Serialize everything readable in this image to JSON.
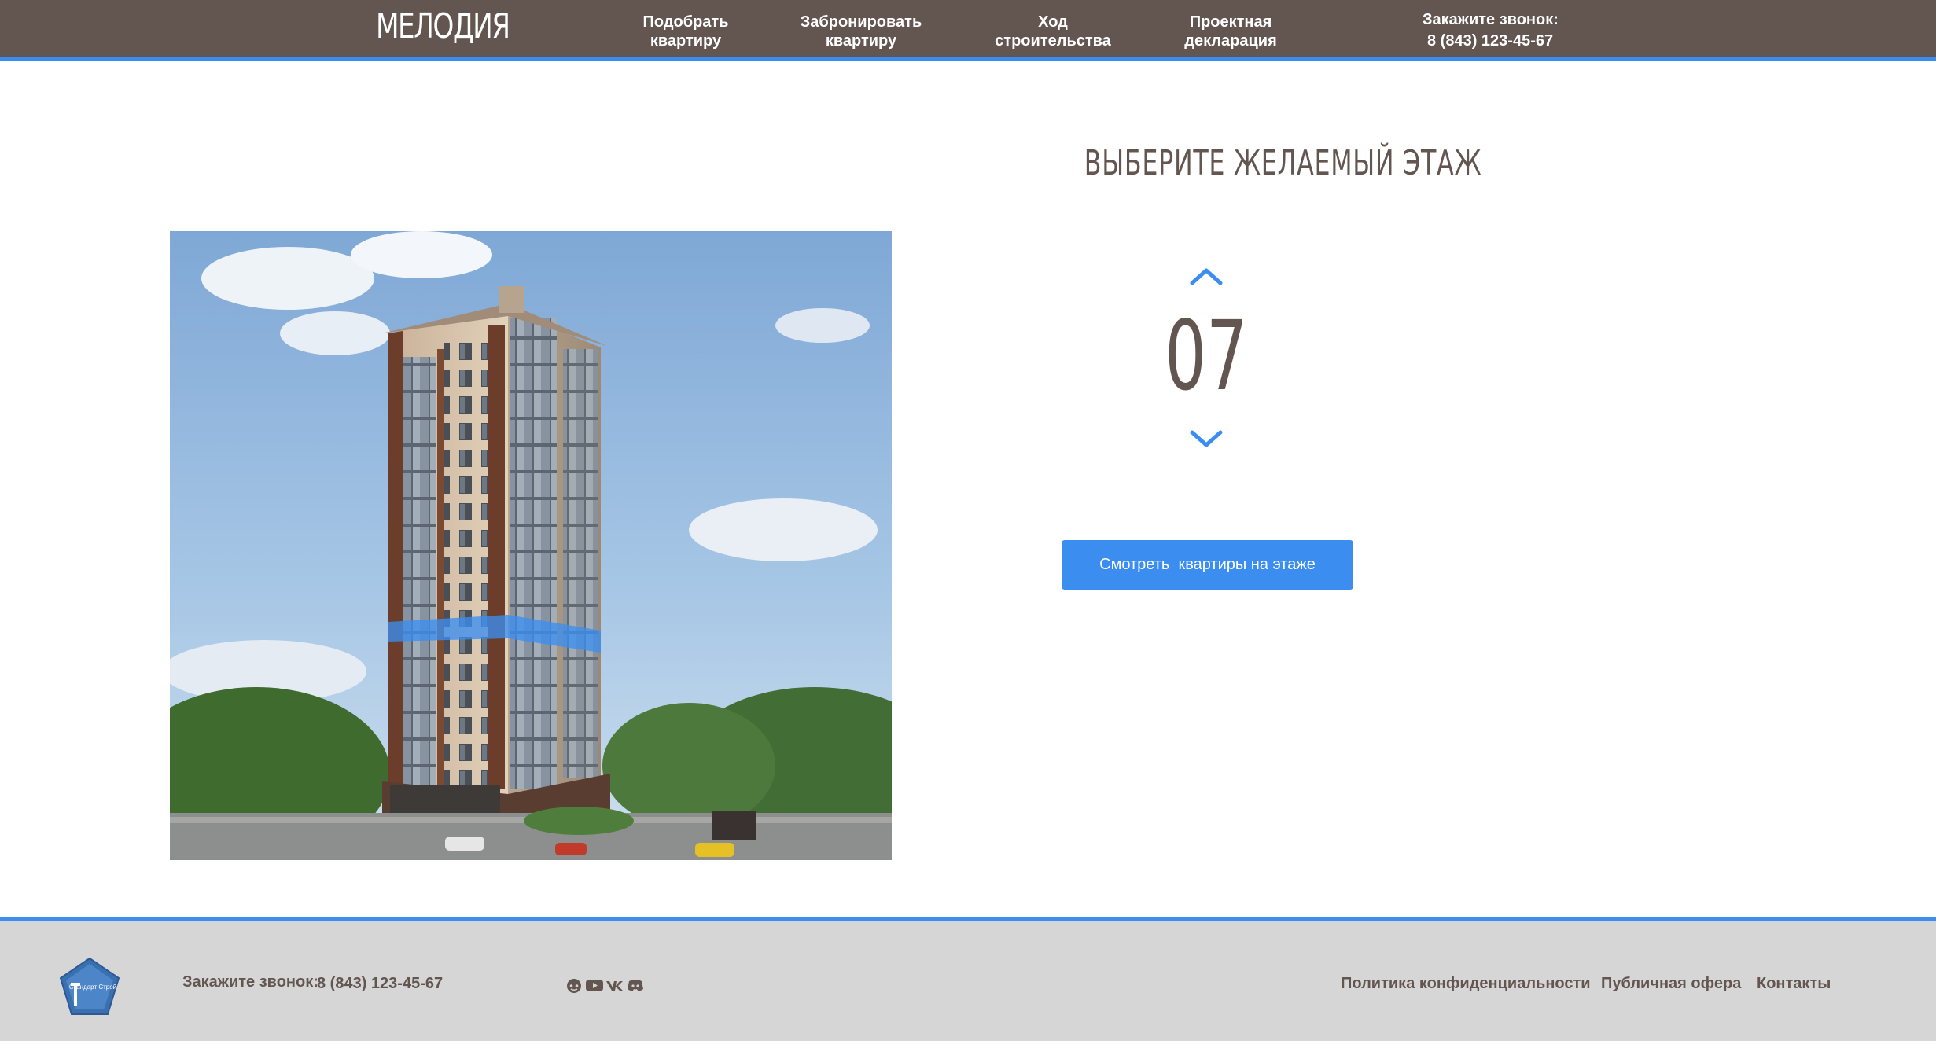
{
  "header": {
    "logo": "МЕЛОДИЯ",
    "nav": [
      {
        "label": "Подобрать\nквартиру"
      },
      {
        "label": "Забронировать\nквартиру"
      },
      {
        "label": "Ход\nстроительства"
      },
      {
        "label": "Проектная\nдекларация"
      }
    ],
    "callout_title": "Закажите звонок:",
    "callout_phone": "8 (843) 123-45-67"
  },
  "main": {
    "title": "ВЫБЕРИТЕ ЖЕЛАЕМЫЙ ЭТАЖ",
    "floor_value": "07",
    "view_button_label": "Смотреть  квартиры на этаже"
  },
  "footer": {
    "logo_text": "Стандарт Строй",
    "call_label": "Закажите звонок:",
    "phone": "8 (843) 123-45-67",
    "socials": [
      "reddit-icon",
      "youtube-icon",
      "vk-icon",
      "discord-icon"
    ],
    "links": [
      "Политика конфиденциальности",
      "Публичная офера",
      "Контакты"
    ]
  },
  "colors": {
    "header_bg": "#635651",
    "accent": "#3b8ef0",
    "footer_bg": "#d7d6d6",
    "text": "#635651"
  }
}
